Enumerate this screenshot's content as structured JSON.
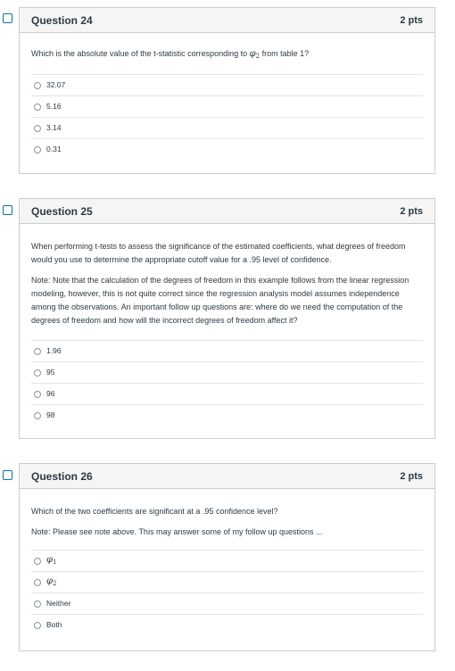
{
  "questions": [
    {
      "title": "Question 24",
      "points": "2 pts",
      "prompt": "Which is the absolute value of the t-statistic corresponding to",
      "prompt_symbol": "φ",
      "prompt_subscript": "2",
      "prompt_tail": "from table 1?",
      "answers": [
        "32.07",
        "5.16",
        "3.14",
        "0.31"
      ]
    },
    {
      "title": "Question 25",
      "points": "2 pts",
      "prompt": "When performing t-tests to assess the significance of the estimated coefficients, what degrees of freedom would you use to determine the appropriate cutoff value for a .95 level of confidence.",
      "note_label": "Note:",
      "note": "Note that the calculation of the degrees of freedom in this example follows from the linear regression modeling, however, this is not quite correct since the regression analysis model assumes independence among the observations. An important follow up questions are: where do we need the computation of the degrees of freedom and how will the incorrect degrees of freedom affect it?",
      "answers": [
        "1.96",
        "95",
        "96",
        "98"
      ]
    },
    {
      "title": "Question 26",
      "points": "2 pts",
      "prompt": "Which of the two coefficients are significant at a .95 confidence level?",
      "note_label": "Note:",
      "note": "Please see note above. This may answer some of my follow up questions ...",
      "answers": [
        {
          "symbol": "φ",
          "subscript": "1"
        },
        {
          "symbol": "φ",
          "subscript": "2"
        },
        "Neither",
        "Both"
      ]
    }
  ]
}
